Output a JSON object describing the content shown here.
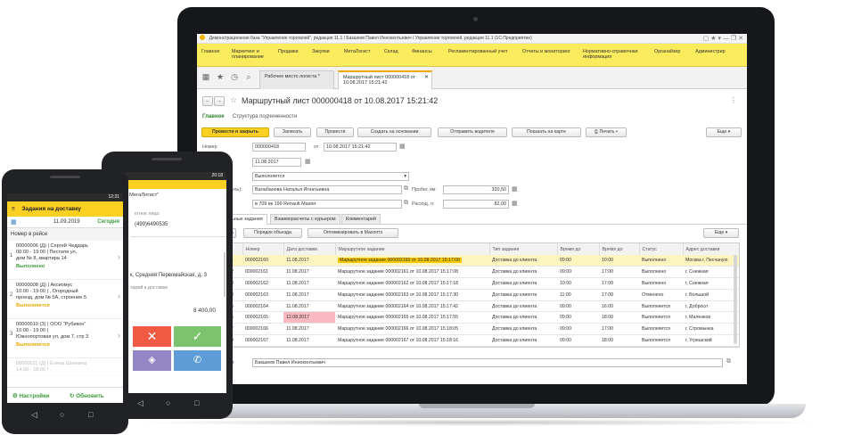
{
  "window": {
    "title": "Демонстрационная база \"Управление торговлей\", редакция 11.1 / Бакшеев Павел Иннокентьевич / Управление торговлей, редакция 11.1 (1С:Предприятие)"
  },
  "menu": [
    "Главное",
    "Маркетинг и планирование",
    "Продажи",
    "Закупки",
    "МетаЛогист",
    "Склад",
    "Финансы",
    "Регламентированный учет",
    "Отчеты и мониторинг",
    "Нормативно-справочная информация",
    "Органайзер",
    "Администрир"
  ],
  "tabs": [
    "Рабочее место логиста *",
    "Маршрутный лист 000000418 от 10.08.2017 15:21:42"
  ],
  "doc": {
    "title": "Маршрутный лист 000000418 от 10.08.2017 15:21:42",
    "link_main": "Главное",
    "link_struct": "Структура подчиненности",
    "more": "Еще"
  },
  "toolbar": [
    "Провести и закрыть",
    "Записать",
    "Провести",
    "Создать на основании",
    "Отправить водителя",
    "Показать на карте",
    "Печать"
  ],
  "form": {
    "number_label": "Номер",
    "number_value": "000000418",
    "from_label": "от",
    "datetime_value": "10.08.2017 15:21:42",
    "date_label": "ки:",
    "date_value": "11.08.2017",
    "status_value": "Выполняется",
    "driver_label": "дитель):",
    "driver_value": "Валабанова Наталья Игнатьевна",
    "vehicle_value": "в 709 вк 199 Renault Master",
    "mileage_label": "Пробег, км:",
    "mileage_value": "320,50",
    "fuel_label": "Расход, л:",
    "fuel_value": "82,00"
  },
  "subtabs": [
    "ьные задания",
    "Взаиморасчеты с курьером",
    "Комментарий"
  ],
  "table_toolbar": [
    "ить",
    "Порядок объезда",
    "Оптимизировать в Махоптэ"
  ],
  "table_more": "Еще",
  "table": {
    "columns": [
      "",
      "Номер",
      "Дата доставки",
      "Маршрутное задание",
      "Тип задания",
      "Время до",
      "Время до",
      "Статус",
      "Адрес доставки"
    ],
    "rows": [
      [
        "1",
        "000002160",
        "11.08.2017",
        "Маршрутное задание 000002160 от 10.08.2017 15:17:00",
        "Доставка до клиента",
        "09:00",
        "10:00",
        "Выполнено",
        "Москва г, Песчаную"
      ],
      [
        "2",
        "000002161",
        "11.08.2017",
        "Маршрутное задание 000002161 от 10.08.2017 15:17:08",
        "Доставка до клиента",
        "09:00",
        "17:00",
        "Выполнено",
        "г, Снежная"
      ],
      [
        "3",
        "000002162",
        "11.08.2017",
        "Маршрутное задание 000002162 от 10.08.2017 15:17:18",
        "Доставка до клиента",
        "10:00",
        "17:00",
        "Выполнено",
        "г, Снежная"
      ],
      [
        "3",
        "000002163",
        "11.08.2017",
        "Маршрутное задание 000002163 от 10.08.2017 15:17:30",
        "Доставка до клиента",
        "11:00",
        "17:00",
        "Отменено",
        "г, Большой"
      ],
      [
        "5",
        "000002164",
        "11.08.2017",
        "Маршрутное задание 000002164 от 10.08.2017 15:17:42",
        "Доставка до клиента",
        "09:00",
        "16:00",
        "Выполняется",
        "г, Добросл"
      ],
      [
        "6",
        "000002165",
        "12.08.2017",
        "Маршрутное задание 000002165 от 10.08.2017 15:17:55",
        "Доставка до клиента",
        "09:00",
        "18:00",
        "Выполняется",
        "г, Маленков"
      ],
      [
        "7",
        "000002166",
        "11.08.2017",
        "Маршрутное задание 000002166 от 10.08.2017 15:18:05",
        "Доставка до клиента",
        "09:00",
        "17:00",
        "Выполняется",
        "г, Стромынка"
      ],
      [
        "8",
        "000002167",
        "11.08.2017",
        "Маршрутное задание 000002167 от 10.08.2017 15:18:16",
        "Доставка до клиента",
        "09:00",
        "18:00",
        "Выполняется",
        "г, Угрешский"
      ]
    ]
  },
  "footer": {
    "label": "ый:",
    "value": "Бакшеев Павел Иннокентьевич"
  },
  "phone_front": {
    "time": "12:31",
    "header": "Задания на доставку",
    "date": "11.09.2019",
    "today": "Сегодня",
    "section": "Номер в рейсе",
    "items": [
      {
        "num": "1",
        "line1": "00000006 (Д) | Сергей Чеддарь",
        "line2": "00:00 - 19:00 |                Пестеля ул,",
        "line3": "дом № 8, квартира 14",
        "status": "Выполнено",
        "state": "done"
      },
      {
        "num": "2",
        "line1": "00000008 (Д) | Аксиомус",
        "line2": "10:00 - 19:00 |                 , Огородный",
        "line3": "проезд, дом № 5А, строение 5",
        "status": "Выполняется",
        "state": "progress"
      },
      {
        "num": "3",
        "line1": "00000010 (З) | ООО \"Рубикон\"",
        "line2": "10:00 - 19:00 |",
        "line3": "Южнопортовая ул, дом 7, стр 3",
        "status": "Выполняется",
        "state": "progress"
      },
      {
        "num": "",
        "line1": "00000011 (Д) | Елена Шинкина",
        "line2": "14:00 - 18:00 |                     ,",
        "line3": "",
        "status": "",
        "state": "faded"
      }
    ],
    "settings": "Настройки",
    "refresh": "Обновить"
  },
  "phone_back": {
    "time": "20:18",
    "org": "МегаЛогист\"",
    "contact": "ктное лицо",
    "phone": "(499)6490535",
    "address": "к, Средняя Первомайская, д. 3",
    "comment": "тарий к доставке",
    "amount": "8 400,00"
  },
  "colors": {
    "accent": "#fcd021",
    "menubar": "#fbec5d",
    "done": "#3c9a3c",
    "progress": "#e6a800",
    "red": "#f15a43",
    "green": "#7cc36d",
    "purple": "#9486c4",
    "blue": "#5d9cd6"
  }
}
